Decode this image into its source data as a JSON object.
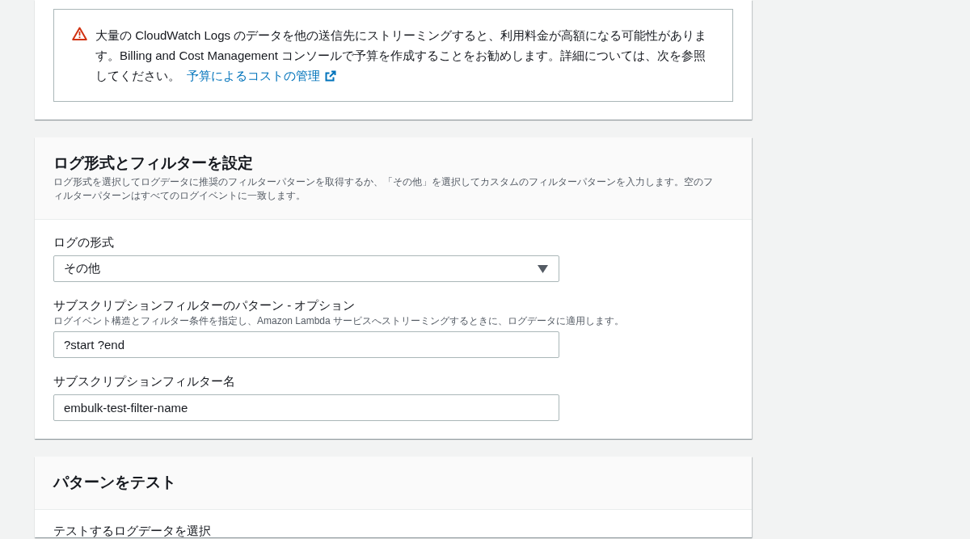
{
  "warning": {
    "text": "大量の CloudWatch Logs のデータを他の送信先にストリーミングすると、利用料金が高額になる可能性があります。Billing and Cost Management コンソールで予算を作成することをお勧めします。詳細については、次を参照してください。",
    "link": "予算によるコストの管理"
  },
  "format_section": {
    "title": "ログ形式とフィルターを設定",
    "description": "ログ形式を選択してログデータに推奨のフィルターパターンを取得するか、「その他」を選択してカスタムのフィルターパターンを入力します。空のフィルターパターンはすべてのログイベントに一致します。",
    "fields": [
      {
        "kind": "select",
        "label": "ログの形式",
        "value": "その他"
      },
      {
        "kind": "text",
        "label": "サブスクリプションフィルターのパターン - オプション",
        "description": "ログイベント構造とフィルター条件を指定し、Amazon Lambda サービスへストリーミングするときに、ログデータに適用します。",
        "value": "?start ?end"
      },
      {
        "kind": "text",
        "label": "サブスクリプションフィルター名",
        "value": "embulk-test-filter-name"
      }
    ]
  },
  "test_section": {
    "title": "パターンをテスト",
    "field_label": "テストするログデータを選択"
  }
}
